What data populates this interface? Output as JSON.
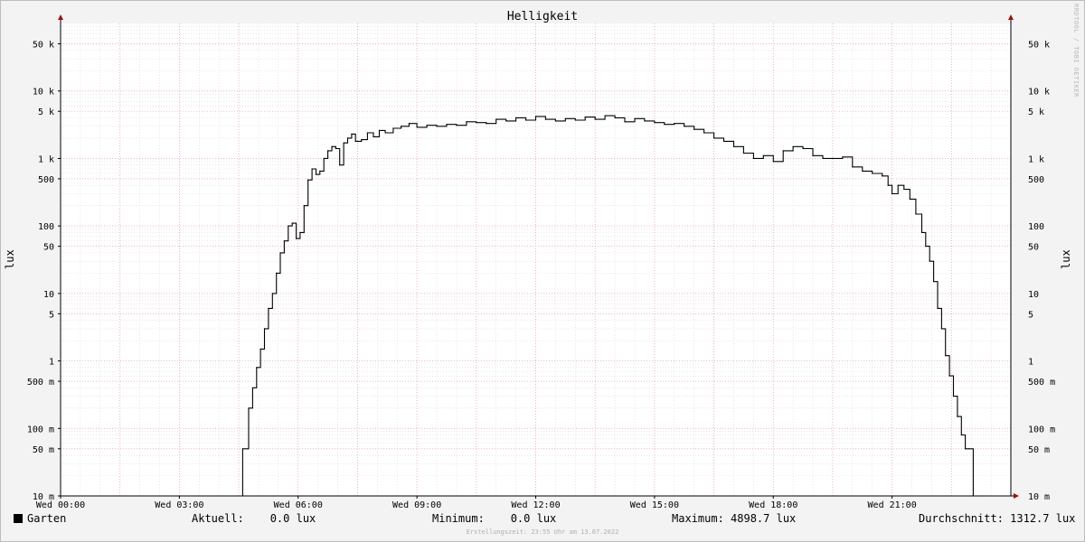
{
  "chart_data": {
    "type": "line",
    "title": "Helligkeit",
    "ylabel": "lux",
    "yscale": "log",
    "ylim": [
      0.01,
      100000
    ],
    "y_ticks": [
      {
        "value": 50000,
        "label": "50 k"
      },
      {
        "value": 10000,
        "label": "10 k"
      },
      {
        "value": 5000,
        "label": "5 k"
      },
      {
        "value": 1000,
        "label": "1 k"
      },
      {
        "value": 500,
        "label": "500"
      },
      {
        "value": 100,
        "label": "100"
      },
      {
        "value": 50,
        "label": "50"
      },
      {
        "value": 10,
        "label": "10"
      },
      {
        "value": 5,
        "label": "5"
      },
      {
        "value": 1,
        "label": "1"
      },
      {
        "value": 0.5,
        "label": "500 m"
      },
      {
        "value": 0.1,
        "label": "100 m"
      },
      {
        "value": 0.05,
        "label": "50 m"
      },
      {
        "value": 0.01,
        "label": "10 m"
      }
    ],
    "xlim": [
      0,
      24
    ],
    "x_ticks": [
      {
        "value": 0,
        "label": "Wed 00:00"
      },
      {
        "value": 3,
        "label": "Wed 03:00"
      },
      {
        "value": 6,
        "label": "Wed 06:00"
      },
      {
        "value": 9,
        "label": "Wed 09:00"
      },
      {
        "value": 12,
        "label": "Wed 12:00"
      },
      {
        "value": 15,
        "label": "Wed 15:00"
      },
      {
        "value": 18,
        "label": "Wed 18:00"
      },
      {
        "value": 21,
        "label": "Wed 21:00"
      }
    ],
    "series": [
      {
        "name": "Garten",
        "color": "#000000",
        "x": [
          0,
          4.6,
          4.75,
          4.85,
          4.95,
          5.05,
          5.15,
          5.25,
          5.35,
          5.45,
          5.55,
          5.65,
          5.75,
          5.85,
          5.95,
          6.05,
          6.15,
          6.25,
          6.35,
          6.45,
          6.55,
          6.65,
          6.75,
          6.85,
          6.95,
          7.05,
          7.15,
          7.25,
          7.35,
          7.45,
          7.6,
          7.75,
          7.9,
          8.05,
          8.2,
          8.4,
          8.6,
          8.8,
          9.0,
          9.25,
          9.5,
          9.75,
          10.0,
          10.25,
          10.5,
          10.75,
          11.0,
          11.25,
          11.5,
          11.75,
          12.0,
          12.25,
          12.5,
          12.75,
          13.0,
          13.25,
          13.5,
          13.75,
          14.0,
          14.25,
          14.5,
          14.75,
          15.0,
          15.25,
          15.5,
          15.75,
          16.0,
          16.25,
          16.5,
          16.75,
          17.0,
          17.25,
          17.5,
          17.75,
          18.0,
          18.25,
          18.5,
          18.75,
          19.0,
          19.25,
          19.5,
          19.75,
          20.0,
          20.25,
          20.5,
          20.75,
          20.9,
          21.0,
          21.15,
          21.3,
          21.45,
          21.6,
          21.75,
          21.85,
          21.95,
          22.05,
          22.15,
          22.25,
          22.35,
          22.45,
          22.55,
          22.65,
          22.75,
          22.85,
          22.95,
          23.05,
          23.2,
          24
        ],
        "y": [
          0.01,
          0.05,
          0.2,
          0.4,
          0.8,
          1.5,
          3,
          6,
          10,
          20,
          40,
          60,
          100,
          110,
          65,
          80,
          200,
          480,
          700,
          580,
          650,
          1000,
          1300,
          1500,
          1400,
          800,
          1700,
          2000,
          2300,
          1800,
          1900,
          2400,
          2100,
          2600,
          2400,
          2800,
          3000,
          3300,
          2900,
          3100,
          3000,
          3200,
          3100,
          3500,
          3400,
          3300,
          3800,
          3600,
          4000,
          3700,
          4200,
          3800,
          3600,
          3900,
          3700,
          4100,
          3800,
          4300,
          4000,
          3500,
          3900,
          3600,
          3400,
          3200,
          3300,
          3000,
          2700,
          2400,
          2000,
          1800,
          1500,
          1200,
          1000,
          1100,
          900,
          1300,
          1500,
          1400,
          1100,
          1000,
          1000,
          1050,
          750,
          650,
          600,
          550,
          400,
          300,
          400,
          350,
          250,
          150,
          80,
          50,
          30,
          15,
          6,
          3,
          1.2,
          0.6,
          0.3,
          0.15,
          0.08,
          0.05,
          0.05,
          0.01,
          0.01,
          0.01
        ]
      }
    ],
    "grid": true,
    "legend_position": "bottom"
  },
  "legend": {
    "series_label": "Garten",
    "current_label": "Aktuell:",
    "current_value": "0.0 lux",
    "min_label": "Minimum:",
    "min_value": "0.0 lux",
    "max_label": "Maximum:",
    "max_value": "4898.7 lux",
    "avg_label": "Durchschnitt:",
    "avg_value": "1312.7 lux"
  },
  "watermark": "RRDTOOL / TOBI OETIKER",
  "footer": "Erstellungszeit: 23:55 Uhr am 13.07.2022"
}
